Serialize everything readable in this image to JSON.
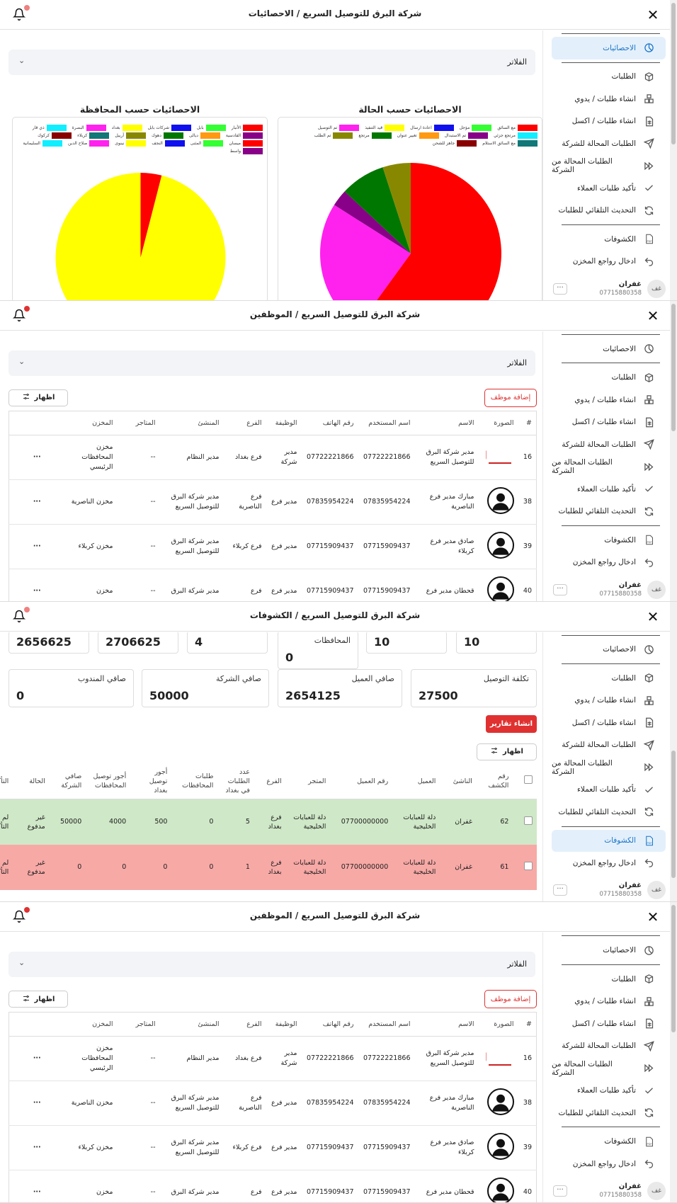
{
  "colors": {
    "accent": "#1a73c9",
    "danger": "#e03131",
    "notify_dot": "#e55"
  },
  "sidebar": {
    "items": [
      {
        "label": "الاحصائيات",
        "icon": "pie-chart-icon"
      },
      {
        "label": "الطلبات",
        "icon": "package-icon"
      },
      {
        "label": "انشاء طلبات / يدوي",
        "icon": "boxes-icon"
      },
      {
        "label": "انشاء طلبات / اكسل",
        "icon": "spreadsheet-icon"
      },
      {
        "label": "الطلبات المحالة للشركة",
        "icon": "send-icon"
      },
      {
        "label": "الطلبات المحالة من الشركة",
        "icon": "fast-forward-icon"
      },
      {
        "label": "تأكيد طلبات العملاء",
        "icon": "check-icon"
      },
      {
        "label": "التحديث التلقائي للطلبات",
        "icon": "refresh-icon"
      },
      {
        "label": "الكشوفات",
        "icon": "pdf-icon"
      },
      {
        "label": "ادخال رواجع المخزن",
        "icon": "undo-icon"
      }
    ],
    "user": {
      "avatar": "غف",
      "name": "غفران",
      "phone": "07715880358",
      "more": "···"
    }
  },
  "panels": [
    {
      "title": "شركة البرق للتوصيل السريع / الاحصائيات"
    },
    {
      "title": "شركة البرق للتوصيل السريع / الموظفين"
    },
    {
      "title": "شركة البرق للتوصيل السريع / الكشوفات"
    },
    {
      "title": "شركة البرق للتوصيل السريع / الموظفين"
    }
  ],
  "filters_label": "الفلاتر",
  "stats": {
    "chart_data": [
      {
        "type": "pie",
        "title": "الاحصائيات حسب الحالة",
        "legend": [
          {
            "label": "مع السائق",
            "color": "#ff0000"
          },
          {
            "label": "مؤجل",
            "color": "#33ff33"
          },
          {
            "label": "اعادة ارسال",
            "color": "#1010ee"
          },
          {
            "label": "قيد التنفيذ",
            "color": "#ffff00"
          },
          {
            "label": "تم التوصيل",
            "color": "#ff22ee"
          },
          {
            "label": "مرتجع جزئي",
            "color": "#11eeff"
          },
          {
            "label": "تم الاستبدال",
            "color": "#880088"
          },
          {
            "label": "تغيير عنوان",
            "color": "#ff9911"
          },
          {
            "label": "مرتجع",
            "color": "#007700"
          },
          {
            "label": "تم الطلب",
            "color": "#888800"
          },
          {
            "label": "مع السائق الاستلام",
            "color": "#117777"
          },
          {
            "label": "جاهز للشحن",
            "color": "#880000"
          }
        ],
        "slices": [
          {
            "label": "مع السائق",
            "value": 60,
            "color": "#ff0000"
          },
          {
            "label": "تم التوصيل",
            "value": 24,
            "color": "#ff22ee"
          },
          {
            "label": "تم الاستبدال",
            "value": 3,
            "color": "#880088"
          },
          {
            "label": "مرتجع",
            "value": 8,
            "color": "#007700"
          },
          {
            "label": "تم الطلب",
            "value": 5,
            "color": "#888800"
          }
        ]
      },
      {
        "type": "pie",
        "title": "الاحصائيات حسب المحافظة",
        "legend": [
          {
            "label": "الأنبار",
            "color": "#ff0000"
          },
          {
            "label": "بابل",
            "color": "#33ff33"
          },
          {
            "label": "شركات بابل",
            "color": "#1010ee"
          },
          {
            "label": "بغداد",
            "color": "#ffff00"
          },
          {
            "label": "البصرة",
            "color": "#ff22ee"
          },
          {
            "label": "ذي قار",
            "color": "#11eeff"
          },
          {
            "label": "القادسية",
            "color": "#880088"
          },
          {
            "label": "ديالى",
            "color": "#ff9911"
          },
          {
            "label": "دهوك",
            "color": "#007700"
          },
          {
            "label": "أربيل",
            "color": "#888800"
          },
          {
            "label": "كربلاء",
            "color": "#117777"
          },
          {
            "label": "كركوك",
            "color": "#880000"
          },
          {
            "label": "ميسان",
            "color": "#ff0000"
          },
          {
            "label": "المثنى",
            "color": "#33ff33"
          },
          {
            "label": "النجف",
            "color": "#1010ee"
          },
          {
            "label": "نينوى",
            "color": "#ffff00"
          },
          {
            "label": "صلاح الدين",
            "color": "#ff22ee"
          },
          {
            "label": "السليمانية",
            "color": "#11eeff"
          },
          {
            "label": "واسط",
            "color": "#880088"
          }
        ],
        "slices": [
          {
            "label": "الأنبار",
            "value": 4,
            "color": "#ff0000"
          },
          {
            "label": "بغداد",
            "value": 96,
            "color": "#ffff00"
          }
        ]
      }
    ]
  },
  "employees": {
    "add_label": "إضافة موظف",
    "show_label": "اظهار",
    "columns": [
      "#",
      "الصورة",
      "الاسم",
      "اسم المستخدم",
      "رقم الهاتف",
      "الوظيفة",
      "الفرع",
      "المنشئ",
      "المتاجر",
      "المخزن"
    ],
    "rows": [
      {
        "id": "16",
        "img": "logo",
        "name": "مدير شركة البرق للتوصيل السريع",
        "username": "07722221866",
        "phone": "07722221866",
        "job": "مدير شركة",
        "branch": "فرع بغداد",
        "creator": "مدير النظام",
        "stores": "--",
        "warehouse": "مخزن المحافظات الرئيسي"
      },
      {
        "id": "38",
        "img": "avatar",
        "name": "مبارك مدير فرع الناصرية",
        "username": "07835954224",
        "phone": "07835954224",
        "job": "مدير فرع",
        "branch": "فرع الناصرية",
        "creator": "مدير شركة البرق للتوصيل السريع",
        "stores": "--",
        "warehouse": "مخزن الناصرية"
      },
      {
        "id": "39",
        "img": "avatar",
        "name": "صادق مدير فرع كربلاء",
        "username": "07715909437",
        "phone": "07715909437",
        "job": "مدير فرع",
        "branch": "فرع كربلاء",
        "creator": "مدير شركة البرق للتوصيل السريع",
        "stores": "--",
        "warehouse": "مخزن كربلاء"
      },
      {
        "id": "40",
        "img": "avatar",
        "name": "قحطان مدير فرع",
        "username": "07715909437",
        "phone": "07715909437",
        "job": "مدير فرع",
        "branch": "فرع",
        "creator": "مدير شركة البرق",
        "stores": "--",
        "warehouse": "مخزن"
      }
    ],
    "more": "···"
  },
  "reports": {
    "top_cards": [
      {
        "label": "",
        "value": "10"
      },
      {
        "label": "",
        "value": "10"
      },
      {
        "label": "المحافظات",
        "value": "0"
      },
      {
        "label": "",
        "value": "4"
      },
      {
        "label": "",
        "value": "2706625"
      },
      {
        "label": "",
        "value": "2656625"
      }
    ],
    "cards": [
      {
        "label": "تكلفة التوصيل",
        "value": "27500"
      },
      {
        "label": "صافي العميل",
        "value": "2654125"
      },
      {
        "label": "صافي الشركة",
        "value": "50000"
      },
      {
        "label": "صافي المندوب",
        "value": "0"
      }
    ],
    "create_label": "انشاء تقارير",
    "show_label": "اظهار",
    "columns": [
      "",
      "رقم الكشف",
      "الناشئ",
      "العميل",
      "رقم العميل",
      "المتجر",
      "الفرع",
      "عدد الطلبات في بغداد",
      "طلبات المحافظات",
      "أجور توصيل بغداد",
      "أجور توصيل المحافظات",
      "صافي الشركة",
      "الحالة",
      "التأكيد"
    ],
    "rows": [
      {
        "no": "62",
        "creator": "غفران",
        "client": "دلة للعبايات الخليجية",
        "client_no": "07700000000",
        "store": "دلة للعبايات الخليجية",
        "branch": "فرع بغداد",
        "baghdad": "5",
        "prov": "0",
        "fee_b": "500",
        "fee_p": "4000",
        "net": "50000",
        "status": "غير مدفوع",
        "confirm": "لم يتم التأكيد",
        "color": "green"
      },
      {
        "no": "61",
        "creator": "غفران",
        "client": "دلة للعبايات الخليجية",
        "client_no": "07700000000",
        "store": "دلة للعبايات الخليجية",
        "branch": "فرع بغداد",
        "baghdad": "1",
        "prov": "0",
        "fee_b": "0",
        "fee_p": "0",
        "net": "0",
        "status": "غير مدفوع",
        "confirm": "لم يتم التأكيد",
        "color": "red"
      }
    ]
  }
}
